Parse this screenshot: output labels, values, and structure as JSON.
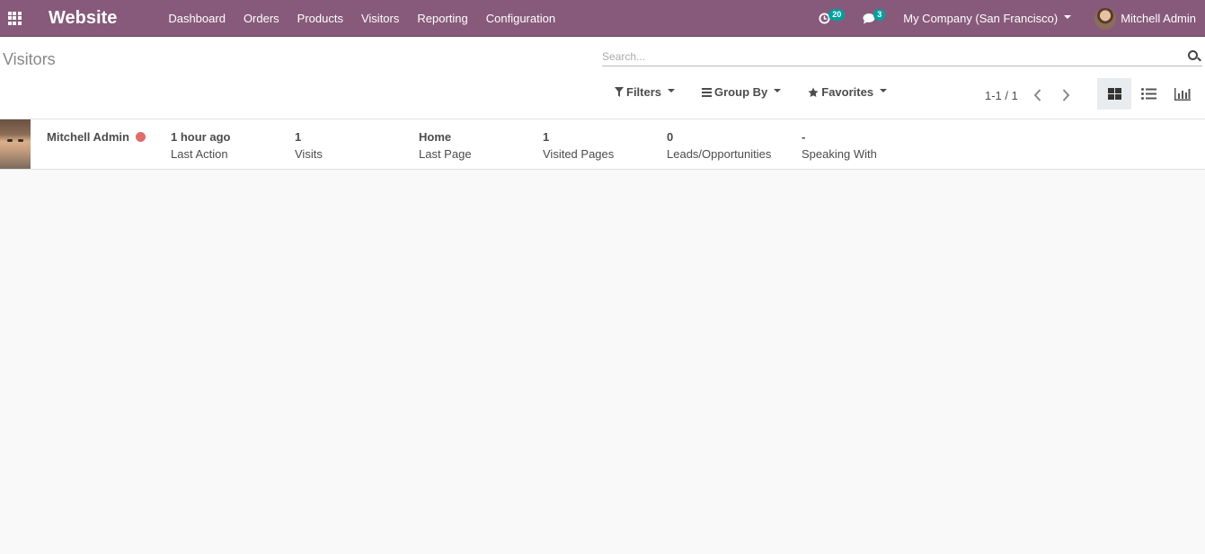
{
  "navbar": {
    "brand": "Website",
    "menu": [
      "Dashboard",
      "Orders",
      "Products",
      "Visitors",
      "Reporting",
      "Configuration"
    ],
    "activity_count": "20",
    "messages_count": "3",
    "company": "My Company (San Francisco)",
    "user": "Mitchell Admin",
    "color": "#875a7b"
  },
  "control_panel": {
    "title": "Visitors",
    "search_placeholder": "Search...",
    "filters_label": "Filters",
    "groupby_label": "Group By",
    "favorites_label": "Favorites",
    "pager": "1-1 / 1"
  },
  "visitor": {
    "name": "Mitchell Admin",
    "status_color": "#d9534f",
    "fields": [
      {
        "value": "1 hour ago",
        "label": "Last Action"
      },
      {
        "value": "1",
        "label": "Visits"
      },
      {
        "value": "Home",
        "label": "Last Page"
      },
      {
        "value": "1",
        "label": "Visited Pages"
      },
      {
        "value": "0",
        "label": "Leads/Opportunities"
      },
      {
        "value": "-",
        "label": "Speaking With"
      }
    ]
  }
}
